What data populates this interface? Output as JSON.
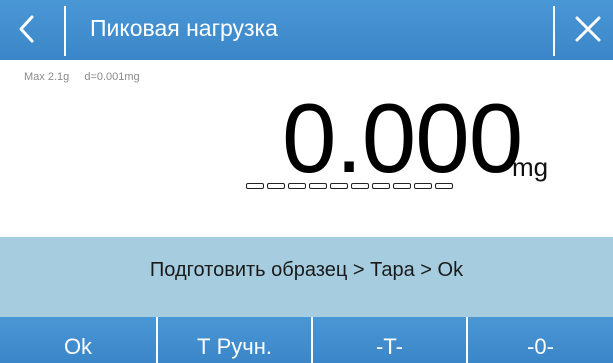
{
  "header": {
    "title": "Пиковая нагрузка",
    "back_icon": "chevron-left-icon",
    "close_icon": "close-icon",
    "color": "#3f8fd2"
  },
  "specs": {
    "max": "Max 2.1g",
    "division": "d=0.001mg"
  },
  "display": {
    "value": "0.000",
    "unit": "mg",
    "bargraph_segments": 10,
    "bargraph_fill": 0
  },
  "message": {
    "text": "Подготовить образец > Тара > Ok",
    "background": "#a6cddf"
  },
  "footer": {
    "buttons": [
      {
        "label": "Ok"
      },
      {
        "label": "Т Ручн."
      },
      {
        "label": "-T-"
      },
      {
        "label": "-0-"
      }
    ]
  }
}
